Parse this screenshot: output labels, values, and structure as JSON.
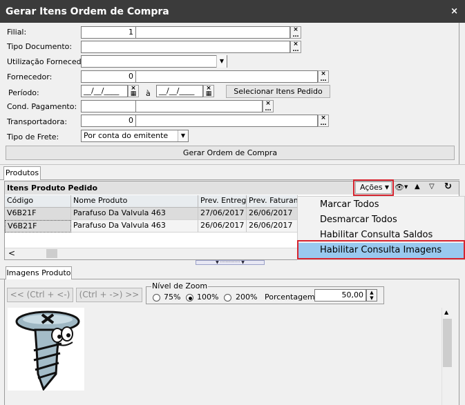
{
  "window": {
    "title": "Gerar Itens Ordem de Compra",
    "close": "×"
  },
  "form": {
    "filial_label": "Filial:",
    "filial_value": "1",
    "tipo_documento_label": "Tipo Documento:",
    "utilizacao_label": "Utilização Fornecedor:",
    "fornecedor_label": "Fornecedor:",
    "fornecedor_value": "0",
    "periodo_label": "Período:",
    "periodo_start": "__/__/____",
    "periodo_sep": "à",
    "periodo_end": "__/__/____",
    "selecionar_label": "Selecionar Itens Pedido",
    "cond_pagamento_label": "Cond. Pagamento:",
    "transportadora_label": "Transportadora:",
    "transportadora_value": "0",
    "tipo_frete_label": "Tipo de Frete:",
    "tipo_frete_value": "Por conta do emitente",
    "gerar_label": "Gerar Ordem de Compra"
  },
  "tabs": {
    "produtos": "Produtos",
    "imagens": "Imagens Produto"
  },
  "grid": {
    "title": "Itens Produto Pedido",
    "acoes_label": "Ações",
    "columns": [
      "Código",
      "Nome Produto",
      "Prev. Entrega",
      "Prev. Faturame"
    ],
    "rows": [
      [
        "V6B21F",
        "Parafuso Da Valvula 463",
        "27/06/2017",
        "26/06/2017"
      ],
      [
        "V6B21F",
        "Parafuso Da Valvula 463",
        "26/06/2017",
        "26/06/2017"
      ]
    ],
    "scroll_left": "<"
  },
  "menu": {
    "items": [
      "Marcar Todos",
      "Desmarcar Todos",
      "Habilitar Consulta Saldos",
      "Habilitar Consulta Imagens"
    ],
    "highlighted_index": 3
  },
  "image_panel": {
    "prev_label": "<< (Ctrl + <-)",
    "next_label": "(Ctrl + ->) >>",
    "zoom_group_label": "Nível de Zoom",
    "zoom_options": [
      "75%",
      "100%",
      "200%"
    ],
    "zoom_selected": "100%",
    "porcentagem_label": "Porcentagem:",
    "porcentagem_value": "50,00"
  },
  "colors": {
    "titlebar": "#3b3b3b",
    "highlight": "#d6232e",
    "menu_selected": "#99c9ef"
  }
}
